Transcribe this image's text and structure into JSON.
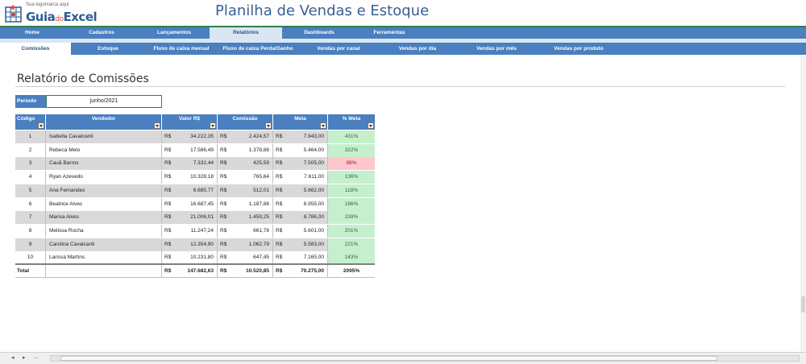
{
  "app": {
    "logo_small": "Sua logomarca aqui",
    "logo_guia": "Guia",
    "logo_do": "do",
    "logo_excel": "Excel",
    "title": "Planilha de Vendas e Estoque"
  },
  "nav_main": [
    {
      "label": "Home",
      "active": false
    },
    {
      "label": "Cadastros",
      "active": false
    },
    {
      "label": "Lançamentos",
      "active": false
    },
    {
      "label": "Relatórios",
      "active": true
    },
    {
      "label": "Dashboards",
      "active": false
    },
    {
      "label": "Ferramentas",
      "active": false
    }
  ],
  "nav_sub": [
    {
      "label": "Comissões",
      "active": true
    },
    {
      "label": "Estoque",
      "active": false
    },
    {
      "label": "Fluxo de caixa mensal",
      "active": false
    },
    {
      "label": "Fluxo de caixa Perda/Ganho",
      "active": false
    },
    {
      "label": "Vendas por canal",
      "active": false
    },
    {
      "label": "Vendas por dia",
      "active": false
    },
    {
      "label": "Vendas por mês",
      "active": false
    },
    {
      "label": "Vendas por produto",
      "active": false
    }
  ],
  "report": {
    "title": "Relatório de Comissões",
    "period_label": "Período",
    "period_value": "junho/2021"
  },
  "table": {
    "headers": [
      "Código",
      "Vendedor",
      "Valor R$",
      "Comissão",
      "Meta",
      "% Meta"
    ],
    "currency": "R$",
    "rows": [
      {
        "code": "1",
        "seller": "Isabella Cavalcanti",
        "value": "34.222,35",
        "commission": "2.424,57",
        "goal": "7.943,00",
        "pct": "431%",
        "status": "good"
      },
      {
        "code": "2",
        "seller": "Rebeca Melo",
        "value": "17.586,49",
        "commission": "1.378,88",
        "goal": "5.464,00",
        "pct": "322%",
        "status": "good"
      },
      {
        "code": "3",
        "seller": "Cauã Barros",
        "value": "7.332,44",
        "commission": "425,59",
        "goal": "7.505,00",
        "pct": "98%",
        "status": "bad"
      },
      {
        "code": "4",
        "seller": "Ryan Azevedo",
        "value": "10.328,18",
        "commission": "765,64",
        "goal": "7.611,00",
        "pct": "136%",
        "status": "good"
      },
      {
        "code": "5",
        "seller": "Ana Fernandes",
        "value": "6.685,77",
        "commission": "512,01",
        "goal": "5.662,00",
        "pct": "118%",
        "status": "good"
      },
      {
        "code": "6",
        "seller": "Beatrice Alves",
        "value": "16.687,45",
        "commission": "1.187,88",
        "goal": "8.955,00",
        "pct": "186%",
        "status": "good"
      },
      {
        "code": "7",
        "seller": "Marisa Alves",
        "value": "21.006,01",
        "commission": "1.459,25",
        "goal": "8.786,00",
        "pct": "239%",
        "status": "good"
      },
      {
        "code": "8",
        "seller": "Melissa Rocha",
        "value": "11.247,24",
        "commission": "661,78",
        "goal": "5.601,00",
        "pct": "201%",
        "status": "good"
      },
      {
        "code": "9",
        "seller": "Carolina Cavalcanti",
        "value": "12.354,90",
        "commission": "1.062,79",
        "goal": "5.583,00",
        "pct": "221%",
        "status": "good"
      },
      {
        "code": "10",
        "seller": "Larissa Martins",
        "value": "10.231,80",
        "commission": "647,45",
        "goal": "7.165,00",
        "pct": "143%",
        "status": "good"
      }
    ],
    "total": {
      "label": "Total",
      "value": "147.682,63",
      "commission": "10.520,85",
      "goal": "70.275,00",
      "pct": "2095%"
    }
  },
  "bottom_bar": {
    "prev": "◂",
    "next": "▸",
    "more": "..."
  },
  "colors": {
    "nav_blue": "#4a7fc0",
    "title_blue": "#3a5f94",
    "good_bg": "#c6efce",
    "bad_bg": "#ffc7ce",
    "accent_green": "#2f7f4f"
  }
}
